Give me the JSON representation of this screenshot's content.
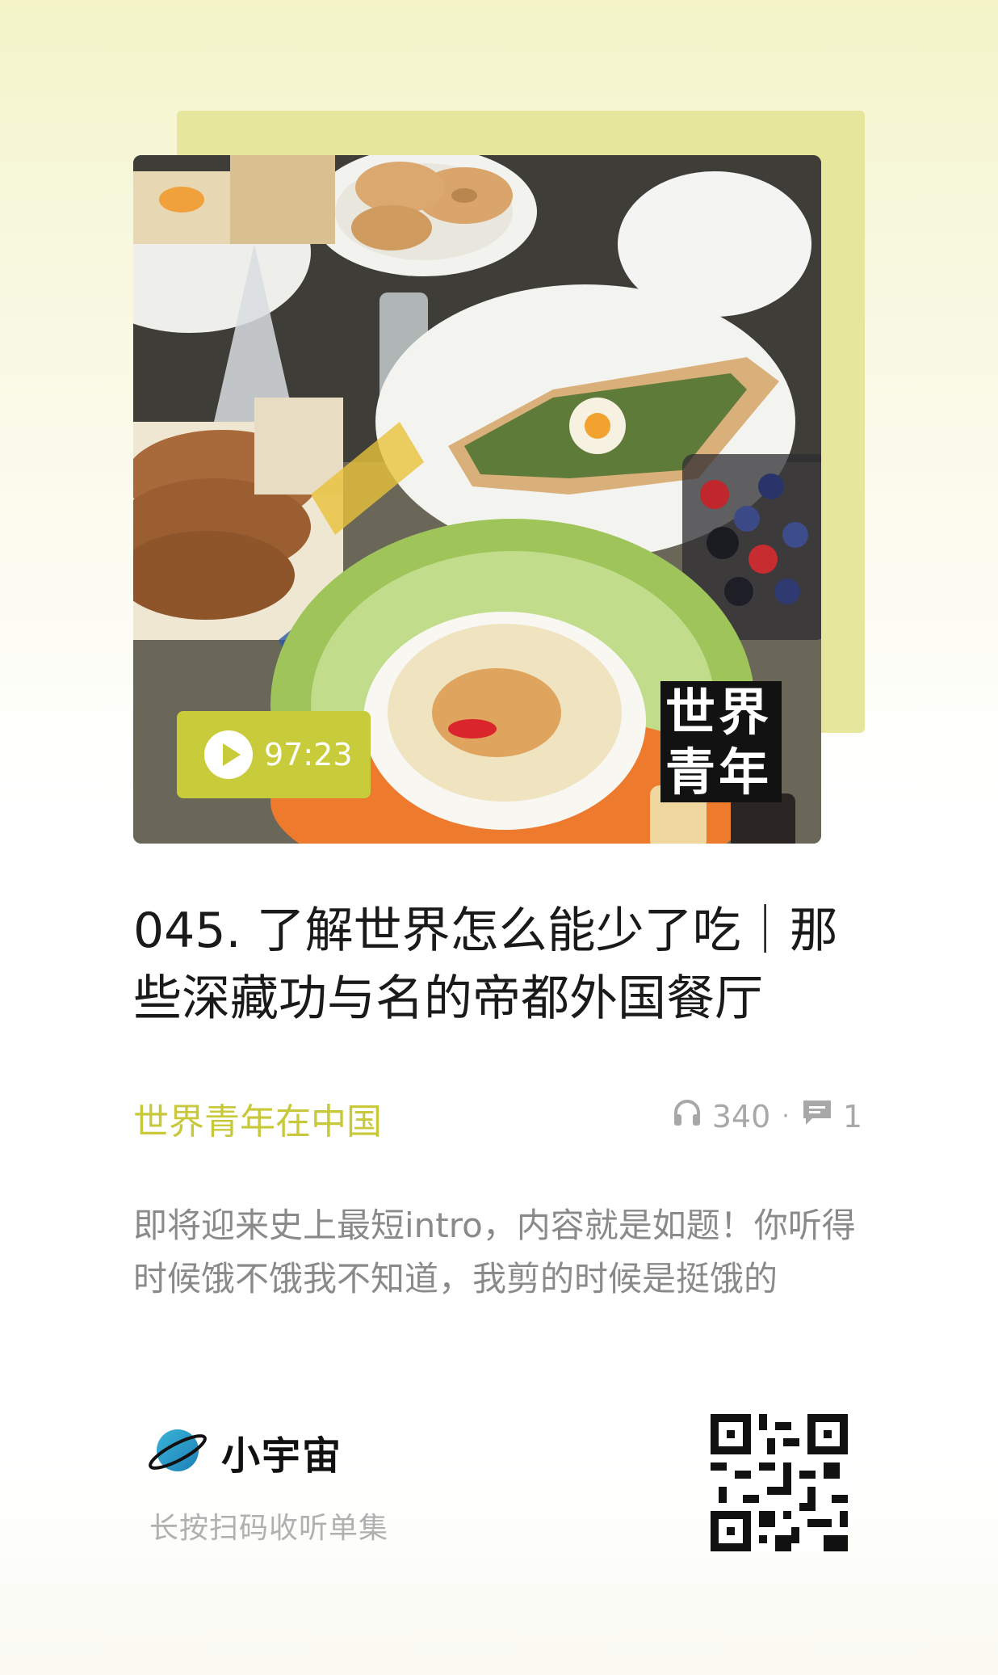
{
  "cover": {
    "duration": "97:23",
    "logo_line1": "世界",
    "logo_line2": "青年"
  },
  "episode": {
    "title": "045. 了解世界怎么能少了吃｜那些深藏功与名的帝都外国餐厅",
    "podcast_name": "世界青年在中国",
    "play_count": "340",
    "comment_count": "1",
    "description": "即将迎来史上最短intro，内容就是如题！你听得时候饿不饿我不知道，我剪的时候是挺饿的"
  },
  "footer": {
    "brand_name": "小宇宙",
    "scan_hint": "长按扫码收听单集"
  },
  "colors": {
    "accent": "#c9cc3a",
    "accent_back": "#e6e69c",
    "title": "#1a1a1a",
    "muted": "#8a8a8a"
  }
}
